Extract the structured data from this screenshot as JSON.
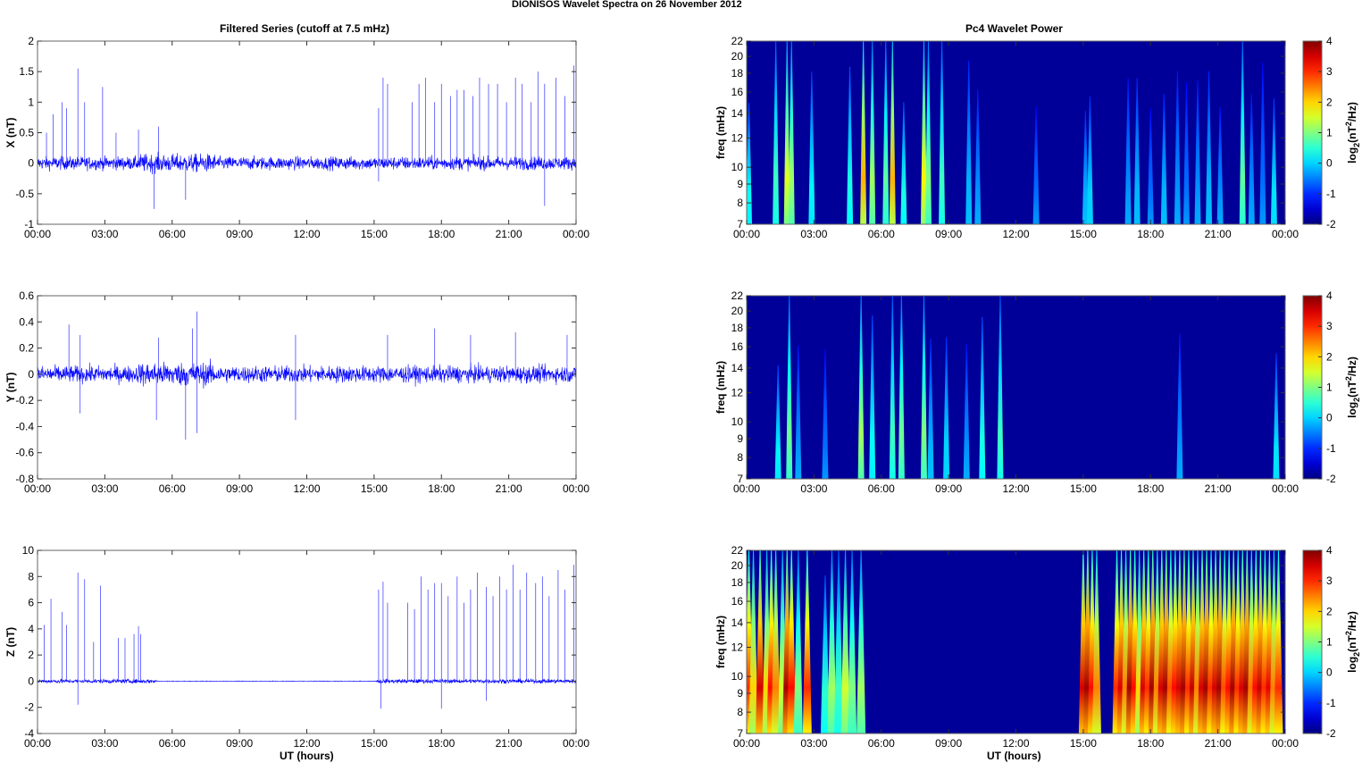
{
  "figure_title": "DIONISOS Wavelet Spectra on 26 November  2012",
  "left_title": "Filtered Series (cutoff at 7.5 mHz)",
  "right_title": "Pc4 Wavelet Power",
  "xlabel": "UT (hours)",
  "chart_data": [
    {
      "type": "line",
      "name": "X",
      "ylabel": "X (nT)",
      "ylim": [
        -1,
        2
      ],
      "yticks": [
        "-1",
        "-0.5",
        "0",
        "0.5",
        "1",
        "1.5",
        "2"
      ],
      "ytick_values": [
        -1,
        -0.5,
        0,
        0.5,
        1,
        1.5,
        2
      ],
      "xlim": [
        0,
        24
      ],
      "xticks": [
        "00:00",
        "03:00",
        "06:00",
        "09:00",
        "12:00",
        "15:00",
        "18:00",
        "21:00",
        "00:00"
      ],
      "noise_amplitude": 0.1,
      "spikes": [
        [
          0.4,
          0.5
        ],
        [
          0.7,
          0.8
        ],
        [
          1.1,
          1.0
        ],
        [
          1.3,
          0.9
        ],
        [
          1.8,
          1.55
        ],
        [
          2.1,
          1.0
        ],
        [
          2.9,
          1.25
        ],
        [
          3.5,
          0.5
        ],
        [
          4.5,
          0.55
        ],
        [
          5.4,
          0.6
        ],
        [
          15.2,
          0.9
        ],
        [
          15.4,
          1.4
        ],
        [
          15.6,
          1.3
        ],
        [
          16.7,
          1.0
        ],
        [
          17.0,
          1.3
        ],
        [
          17.3,
          1.4
        ],
        [
          17.7,
          1.0
        ],
        [
          18.0,
          1.3
        ],
        [
          18.4,
          1.1
        ],
        [
          18.7,
          1.2
        ],
        [
          19.0,
          1.2
        ],
        [
          19.4,
          1.1
        ],
        [
          19.7,
          1.4
        ],
        [
          20.1,
          1.3
        ],
        [
          20.5,
          1.3
        ],
        [
          20.9,
          1.0
        ],
        [
          21.3,
          1.4
        ],
        [
          21.6,
          1.3
        ],
        [
          22.0,
          1.0
        ],
        [
          22.3,
          1.5
        ],
        [
          22.6,
          1.3
        ],
        [
          23.1,
          1.4
        ],
        [
          23.5,
          1.1
        ],
        [
          23.9,
          1.6
        ]
      ],
      "neg_spikes": [
        [
          5.2,
          -0.75
        ],
        [
          6.6,
          -0.6
        ],
        [
          15.2,
          -0.3
        ],
        [
          22.6,
          -0.7
        ]
      ]
    },
    {
      "type": "line",
      "name": "Y",
      "ylabel": "Y (nT)",
      "ylim": [
        -0.8,
        0.6
      ],
      "yticks": [
        "-0.8",
        "-0.6",
        "-0.4",
        "-0.2",
        "0",
        "0.2",
        "0.4",
        "0.6"
      ],
      "ytick_values": [
        -0.8,
        -0.6,
        -0.4,
        -0.2,
        0,
        0.2,
        0.4,
        0.6
      ],
      "xlim": [
        0,
        24
      ],
      "xticks": [
        "00:00",
        "03:00",
        "06:00",
        "09:00",
        "12:00",
        "15:00",
        "18:00",
        "21:00",
        "00:00"
      ],
      "noise_amplitude": 0.06,
      "spikes": [
        [
          1.4,
          0.38
        ],
        [
          1.9,
          0.3
        ],
        [
          5.4,
          0.28
        ],
        [
          6.9,
          0.35
        ],
        [
          7.1,
          0.48
        ],
        [
          11.5,
          0.3
        ],
        [
          15.6,
          0.3
        ],
        [
          17.7,
          0.35
        ],
        [
          19.3,
          0.3
        ],
        [
          21.3,
          0.32
        ],
        [
          23.6,
          0.3
        ]
      ],
      "neg_spikes": [
        [
          1.9,
          -0.3
        ],
        [
          5.3,
          -0.35
        ],
        [
          6.6,
          -0.5
        ],
        [
          7.1,
          -0.45
        ],
        [
          11.5,
          -0.35
        ]
      ]
    },
    {
      "type": "line",
      "name": "Z",
      "ylabel": "Z (nT)",
      "ylim": [
        -4,
        10
      ],
      "yticks": [
        "-4",
        "-2",
        "0",
        "2",
        "4",
        "6",
        "8",
        "10"
      ],
      "ytick_values": [
        -4,
        -2,
        0,
        2,
        4,
        6,
        8,
        10
      ],
      "xlim": [
        0,
        24
      ],
      "xticks": [
        "00:00",
        "03:00",
        "06:00",
        "09:00",
        "12:00",
        "15:00",
        "18:00",
        "21:00",
        "00:00"
      ],
      "noise_amplitude": 0.15,
      "spikes": [
        [
          0.3,
          4.3
        ],
        [
          0.6,
          6.3
        ],
        [
          1.1,
          5.3
        ],
        [
          1.3,
          4.3
        ],
        [
          1.8,
          8.3
        ],
        [
          2.1,
          7.8
        ],
        [
          2.5,
          3.0
        ],
        [
          2.8,
          7.3
        ],
        [
          3.6,
          3.3
        ],
        [
          3.9,
          3.3
        ],
        [
          4.3,
          3.6
        ],
        [
          4.5,
          4.2
        ],
        [
          4.6,
          3.6
        ],
        [
          15.2,
          7.0
        ],
        [
          15.4,
          7.6
        ],
        [
          15.6,
          6.0
        ],
        [
          16.5,
          6.0
        ],
        [
          16.8,
          5.5
        ],
        [
          17.1,
          8.0
        ],
        [
          17.4,
          7.0
        ],
        [
          17.7,
          7.5
        ],
        [
          18.0,
          7.5
        ],
        [
          18.3,
          6.5
        ],
        [
          18.7,
          8.0
        ],
        [
          19.0,
          6.0
        ],
        [
          19.3,
          7.0
        ],
        [
          19.6,
          8.3
        ],
        [
          20.0,
          7.2
        ],
        [
          20.3,
          6.5
        ],
        [
          20.6,
          8.0
        ],
        [
          20.9,
          7.0
        ],
        [
          21.2,
          8.9
        ],
        [
          21.5,
          7.0
        ],
        [
          21.8,
          8.3
        ],
        [
          22.2,
          7.5
        ],
        [
          22.5,
          8.0
        ],
        [
          22.8,
          6.5
        ],
        [
          23.2,
          8.5
        ],
        [
          23.5,
          7.0
        ],
        [
          23.9,
          8.9
        ]
      ],
      "neg_spikes": [
        [
          1.8,
          -1.8
        ],
        [
          15.3,
          -2.1
        ],
        [
          18.0,
          -2.1
        ],
        [
          20.0,
          -1.5
        ]
      ]
    },
    {
      "type": "heatmap",
      "name": "X-power",
      "ylabel": "freq (mHz)",
      "ylim": [
        7,
        22
      ],
      "yscale": "log",
      "yticks": [
        "7",
        "8",
        "9",
        "10",
        "12",
        "14",
        "16",
        "18",
        "20",
        "22"
      ],
      "ytick_values": [
        7,
        8,
        9,
        10,
        12,
        14,
        16,
        18,
        20,
        22
      ],
      "clim": [
        -2,
        4
      ],
      "cbar_ticks": [
        "-2",
        "-1",
        "0",
        "1",
        "2",
        "3",
        "4"
      ],
      "cbar_label": "log2(nT²/Hz)",
      "events": [
        [
          0.1,
          0.3
        ],
        [
          1.3,
          0.6
        ],
        [
          1.8,
          1.6
        ],
        [
          2.0,
          1.2
        ],
        [
          2.9,
          0.2
        ],
        [
          4.6,
          0.4
        ],
        [
          5.2,
          2.2
        ],
        [
          5.6,
          1.2
        ],
        [
          6.2,
          0.8
        ],
        [
          6.5,
          2.2
        ],
        [
          7.0,
          0.4
        ],
        [
          7.9,
          1.8
        ],
        [
          8.1,
          1.0
        ],
        [
          8.7,
          0.6
        ],
        [
          9.9,
          -0.2
        ],
        [
          10.3,
          -0.4
        ],
        [
          12.9,
          -0.6
        ],
        [
          15.1,
          -0.2
        ],
        [
          15.3,
          0.0
        ],
        [
          17.0,
          -0.4
        ],
        [
          17.4,
          -0.2
        ],
        [
          18.0,
          -0.6
        ],
        [
          18.6,
          -0.2
        ],
        [
          19.2,
          -0.4
        ],
        [
          19.6,
          -0.6
        ],
        [
          20.1,
          -0.4
        ],
        [
          20.6,
          -0.2
        ],
        [
          21.1,
          -0.4
        ],
        [
          22.1,
          0.8
        ],
        [
          22.5,
          -0.4
        ],
        [
          23.0,
          -0.6
        ],
        [
          23.5,
          0.1
        ]
      ]
    },
    {
      "type": "heatmap",
      "name": "Y-power",
      "ylabel": "freq (mHz)",
      "ylim": [
        7,
        22
      ],
      "yscale": "log",
      "yticks": [
        "7",
        "8",
        "9",
        "10",
        "12",
        "14",
        "16",
        "18",
        "20",
        "22"
      ],
      "ytick_values": [
        7,
        8,
        9,
        10,
        12,
        14,
        16,
        18,
        20,
        22
      ],
      "clim": [
        -2,
        4
      ],
      "cbar_ticks": [
        "-2",
        "-1",
        "0",
        "1",
        "2",
        "3",
        "4"
      ],
      "cbar_label": "log2(nT²/Hz)",
      "events": [
        [
          1.4,
          0.2
        ],
        [
          1.9,
          0.9
        ],
        [
          2.3,
          -0.4
        ],
        [
          3.5,
          -0.6
        ],
        [
          5.1,
          1.2
        ],
        [
          5.6,
          0.3
        ],
        [
          6.5,
          0.6
        ],
        [
          6.9,
          0.9
        ],
        [
          7.9,
          1.0
        ],
        [
          8.2,
          -0.2
        ],
        [
          8.9,
          0.0
        ],
        [
          9.8,
          -0.4
        ],
        [
          10.5,
          0.4
        ],
        [
          11.3,
          0.6
        ],
        [
          19.3,
          -0.4
        ],
        [
          23.6,
          0.1
        ]
      ]
    },
    {
      "type": "heatmap",
      "name": "Z-power",
      "ylabel": "freq (mHz)",
      "ylim": [
        7,
        22
      ],
      "yscale": "log",
      "yticks": [
        "7",
        "8",
        "9",
        "10",
        "12",
        "14",
        "16",
        "18",
        "20",
        "22"
      ],
      "ytick_values": [
        7,
        8,
        9,
        10,
        12,
        14,
        16,
        18,
        20,
        22
      ],
      "clim": [
        -2,
        4
      ],
      "cbar_ticks": [
        "-2",
        "-1",
        "0",
        "1",
        "2",
        "3",
        "4"
      ],
      "cbar_label": "log2(nT²/Hz)",
      "events": [
        [
          0.1,
          3.0
        ],
        [
          0.3,
          2.0
        ],
        [
          0.6,
          3.5
        ],
        [
          0.9,
          2.0
        ],
        [
          1.1,
          3.2
        ],
        [
          1.3,
          2.5
        ],
        [
          1.6,
          1.5
        ],
        [
          1.8,
          3.8
        ],
        [
          2.0,
          3.2
        ],
        [
          2.3,
          1.0
        ],
        [
          2.7,
          3.0
        ],
        [
          3.5,
          0.5
        ],
        [
          3.8,
          1.2
        ],
        [
          4.1,
          0.6
        ],
        [
          4.4,
          1.5
        ],
        [
          4.7,
          1.0
        ],
        [
          5.1,
          1.2
        ],
        [
          15.0,
          3.5
        ],
        [
          15.2,
          3.8
        ],
        [
          15.4,
          3.2
        ],
        [
          15.6,
          2.5
        ],
        [
          16.5,
          3.0
        ],
        [
          16.7,
          3.5
        ],
        [
          16.9,
          2.5
        ],
        [
          17.1,
          3.8
        ],
        [
          17.3,
          3.2
        ],
        [
          17.5,
          2.0
        ],
        [
          17.7,
          3.5
        ],
        [
          17.9,
          3.0
        ],
        [
          18.1,
          3.8
        ],
        [
          18.3,
          2.5
        ],
        [
          18.5,
          3.5
        ],
        [
          18.7,
          3.8
        ],
        [
          18.9,
          2.8
        ],
        [
          19.1,
          3.2
        ],
        [
          19.3,
          3.5
        ],
        [
          19.5,
          3.8
        ],
        [
          19.7,
          3.0
        ],
        [
          19.9,
          3.6
        ],
        [
          20.1,
          2.5
        ],
        [
          20.3,
          3.5
        ],
        [
          20.5,
          3.8
        ],
        [
          20.7,
          3.0
        ],
        [
          20.9,
          3.5
        ],
        [
          21.1,
          3.8
        ],
        [
          21.3,
          2.8
        ],
        [
          21.5,
          3.2
        ],
        [
          21.7,
          3.8
        ],
        [
          21.9,
          3.0
        ],
        [
          22.1,
          3.5
        ],
        [
          22.3,
          3.8
        ],
        [
          22.5,
          2.6
        ],
        [
          22.7,
          3.2
        ],
        [
          22.9,
          3.6
        ],
        [
          23.1,
          3.0
        ],
        [
          23.3,
          3.4
        ],
        [
          23.5,
          2.5
        ],
        [
          23.7,
          3.0
        ]
      ]
    }
  ]
}
